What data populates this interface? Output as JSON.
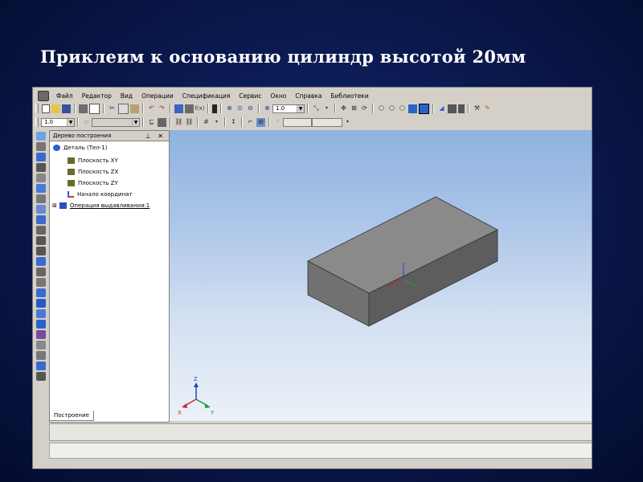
{
  "slide": {
    "title": "Приклеим к основанию цилиндр высотой 20мм"
  },
  "menu": {
    "items": [
      "Файл",
      "Редактор",
      "Вид",
      "Операции",
      "Спецификация",
      "Сервис",
      "Окно",
      "Справка",
      "Библиотеки"
    ]
  },
  "toolbar": {
    "zoom_value": "1.0",
    "step_value": "1.0"
  },
  "tree": {
    "title": "Дерево построения",
    "header_buttons": "⊥ ✕",
    "root": "Деталь (Тел-1)",
    "items": [
      "Плоскость XY",
      "Плоскость ZX",
      "Плоскость ZY",
      "Начало координат",
      "Операция выдавливания:1"
    ],
    "tab": "Построение"
  },
  "axes": {
    "z": "Z",
    "x": "X",
    "y": "Y"
  },
  "colors": {
    "slide_bg": "#0b1a52",
    "title": "#ffffff",
    "window": "#d4d0c8",
    "box_top": "#8a8a8a",
    "box_front": "#717171",
    "box_side": "#5d5d5d"
  },
  "icons": [
    "app-icon",
    "new-icon",
    "open-icon",
    "save-icon",
    "print-icon",
    "cut-icon",
    "copy-icon",
    "paste-icon",
    "undo-icon",
    "redo-icon",
    "zoom-in-icon",
    "zoom-out-icon",
    "rotate-icon",
    "move-icon",
    "shade-icon"
  ]
}
